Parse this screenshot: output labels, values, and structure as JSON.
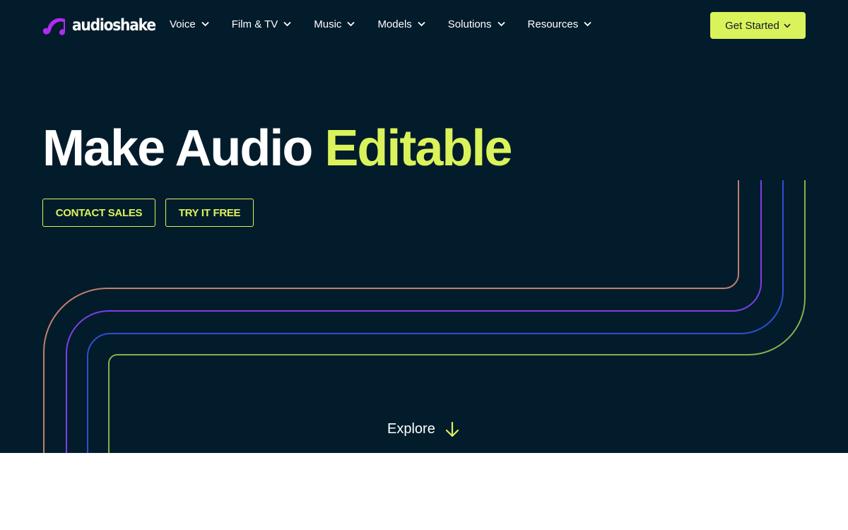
{
  "brand": {
    "name": "audioshake",
    "logo_icon": "music-note-icon",
    "logo_color": "#b02cf0"
  },
  "nav": {
    "items": [
      {
        "label": "Voice",
        "icon": "chevron-down-icon"
      },
      {
        "label": "Film & TV",
        "icon": "chevron-down-icon"
      },
      {
        "label": "Music",
        "icon": "chevron-down-icon"
      },
      {
        "label": "Models",
        "icon": "chevron-down-icon"
      },
      {
        "label": "Solutions",
        "icon": "chevron-down-icon"
      },
      {
        "label": "Resources",
        "icon": "chevron-down-icon"
      }
    ],
    "cta_label": "Get Started"
  },
  "hero": {
    "headline_main": "Make Audio",
    "headline_accent": "Editable",
    "contact_sales_label": "CONTACT SALES",
    "try_free_label": "TRY IT FREE",
    "explore_label": "Explore",
    "explore_icon": "arrow-down-icon"
  },
  "colors": {
    "background": "#031c2c",
    "accent": "#dbf35a",
    "line_orange": "#c0806a",
    "line_purple": "#7d3fe6",
    "line_blue": "#2f4fd0",
    "line_green": "#86b04a"
  }
}
